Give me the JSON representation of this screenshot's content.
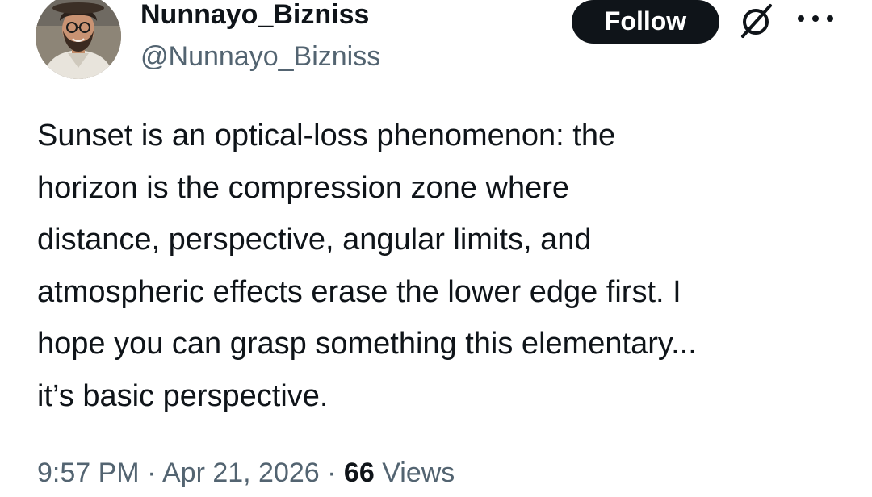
{
  "author": {
    "display_name": "Nunnayo_Bizniss",
    "handle": "@Nunnayo_Bizniss"
  },
  "actions": {
    "follow_label": "Follow",
    "grok_icon": "grok-slashed-circle-icon",
    "more_icon": "more-dots-icon"
  },
  "tweet": {
    "lines": [
      "Sunset is an optical-loss phenomenon: the",
      "horizon is the compression zone where",
      "distance, perspective, angular limits, and",
      "atmospheric effects erase the lower edge first. I",
      "hope you can grasp something this elementary...",
      "it’s basic perspective."
    ]
  },
  "meta": {
    "time": "9:57 PM",
    "separator": "·",
    "date": "Apr 21, 2026",
    "views_count": "66",
    "views_label": "Views"
  },
  "colors": {
    "text_primary": "#0f1419",
    "text_secondary": "#536471",
    "follow_bg": "#0f1419",
    "follow_text": "#ffffff"
  }
}
